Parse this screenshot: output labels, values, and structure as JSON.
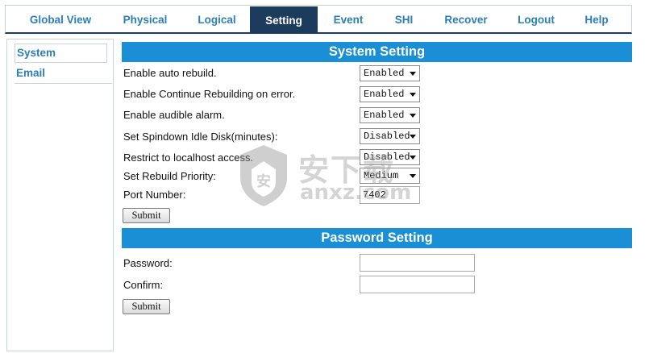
{
  "nav": {
    "tabs": [
      {
        "label": "Global View"
      },
      {
        "label": "Physical"
      },
      {
        "label": "Logical"
      },
      {
        "label": "Setting"
      },
      {
        "label": "Event"
      },
      {
        "label": "SHI"
      },
      {
        "label": "Recover"
      },
      {
        "label": "Logout"
      },
      {
        "label": "Help"
      }
    ],
    "active_tab": "Setting"
  },
  "sidebar": {
    "items": [
      {
        "label": "System"
      },
      {
        "label": "Email"
      }
    ],
    "selected": "System"
  },
  "system_setting": {
    "title": "System Setting",
    "rows": [
      {
        "label": "Enable auto rebuild.",
        "value": "Enabled"
      },
      {
        "label": "Enable Continue Rebuilding on error.",
        "value": "Enabled"
      },
      {
        "label": "Enable audible alarm.",
        "value": "Enabled"
      },
      {
        "label": "Set Spindown Idle Disk(minutes):",
        "value": "Disabled"
      },
      {
        "label": "Restrict to localhost access.",
        "value": "Disabled"
      },
      {
        "label": "Set Rebuild Priority:",
        "value": "Medium"
      }
    ],
    "port": {
      "label": "Port Number:",
      "value": "7402"
    },
    "submit_label": "Submit"
  },
  "password_setting": {
    "title": "Password Setting",
    "password_label": "Password:",
    "confirm_label": "Confirm:",
    "password_value": "",
    "confirm_value": "",
    "submit_label": "Submit"
  },
  "watermark": {
    "big_text": "安下载",
    "small_text": "anxz.com"
  },
  "colors": {
    "nav_active_bg": "#1d3b5c",
    "link_blue": "#2b7fb8",
    "section_header_bg": "#1a8fd6"
  }
}
